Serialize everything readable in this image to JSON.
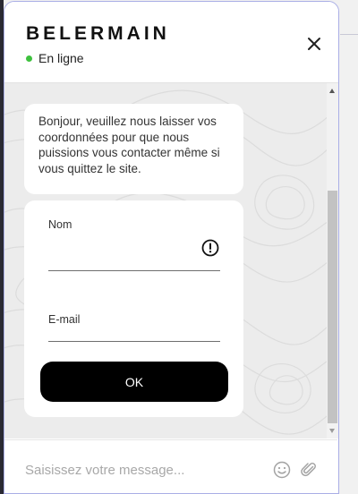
{
  "header": {
    "brand": "BELERMAIN",
    "status": "En ligne",
    "close_icon": "close-icon"
  },
  "chat": {
    "welcome_message": "Bonjour, veuillez nous laisser vos coordonnées pour que nous puissions vous contacter même si vous quittez le site."
  },
  "form": {
    "name_label": "Nom",
    "name_value": "",
    "name_warning_icon": "exclamation-circle-icon",
    "email_label": "E-mail",
    "email_value": "",
    "submit_label": "OK"
  },
  "composer": {
    "placeholder": "Saisissez votre message...",
    "emoji_icon": "emoji-icon",
    "attach_icon": "paperclip-icon"
  },
  "colors": {
    "status_online": "#3ec13e",
    "button_bg": "#000000",
    "widget_border": "#a9aee6",
    "chat_bg": "#ececec"
  }
}
